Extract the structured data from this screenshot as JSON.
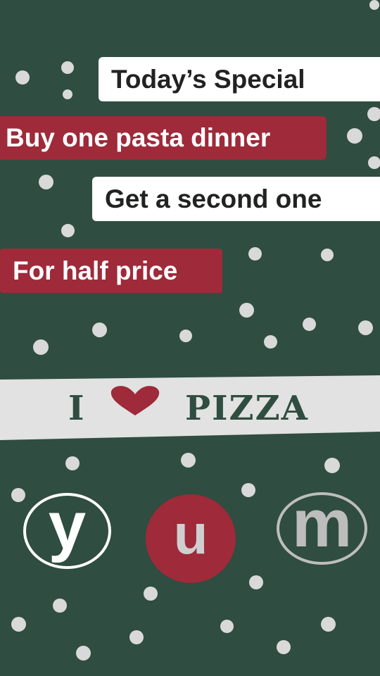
{
  "lines": {
    "l1": "Today’s Special",
    "l2": "Buy one pasta dinner",
    "l3": "Get a second one",
    "l4": "For half price"
  },
  "banner": {
    "left_text": "I",
    "right_text": "PIZZA",
    "heart_icon": "heart-icon"
  },
  "circles": {
    "y": "y",
    "u": "u",
    "m": "m"
  },
  "colors": {
    "background": "#2f4d40",
    "accent_red": "#9e2a3a",
    "white": "#ffffff",
    "dot": "#d9d9d9"
  }
}
